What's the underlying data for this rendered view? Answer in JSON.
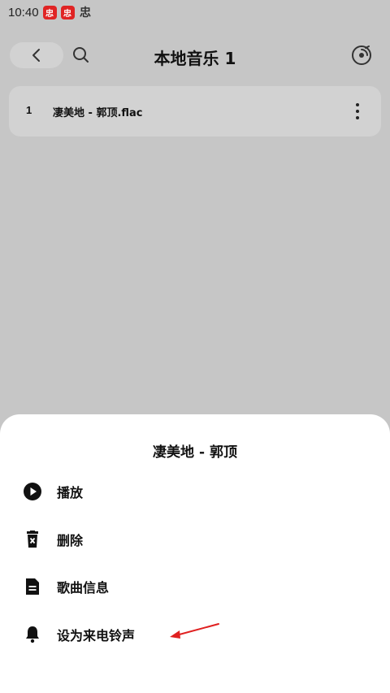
{
  "status_bar": {
    "time": "10:40",
    "badges": [
      "忠",
      "忠"
    ],
    "extra_icon": "忠"
  },
  "header": {
    "title": "本地音乐 1",
    "icons": [
      "back-arrow-icon",
      "search-icon",
      "disc-icon"
    ]
  },
  "song_list": [
    {
      "index": "1",
      "name": "凄美地 - 郭顶.flac"
    }
  ],
  "sheet": {
    "title": "凄美地 - 郭顶",
    "items": [
      {
        "label": "播放",
        "icon": "play-circle-icon"
      },
      {
        "label": "删除",
        "icon": "trash-icon"
      },
      {
        "label": "歌曲信息",
        "icon": "document-icon"
      },
      {
        "label": "设为来电铃声",
        "icon": "bell-icon"
      }
    ]
  },
  "colors": {
    "overlay_background": "#c6c6c6",
    "card": "#d2d2d2",
    "sheet": "#ffffff",
    "annotation_arrow": "#e02020",
    "badge": "#e02424"
  }
}
